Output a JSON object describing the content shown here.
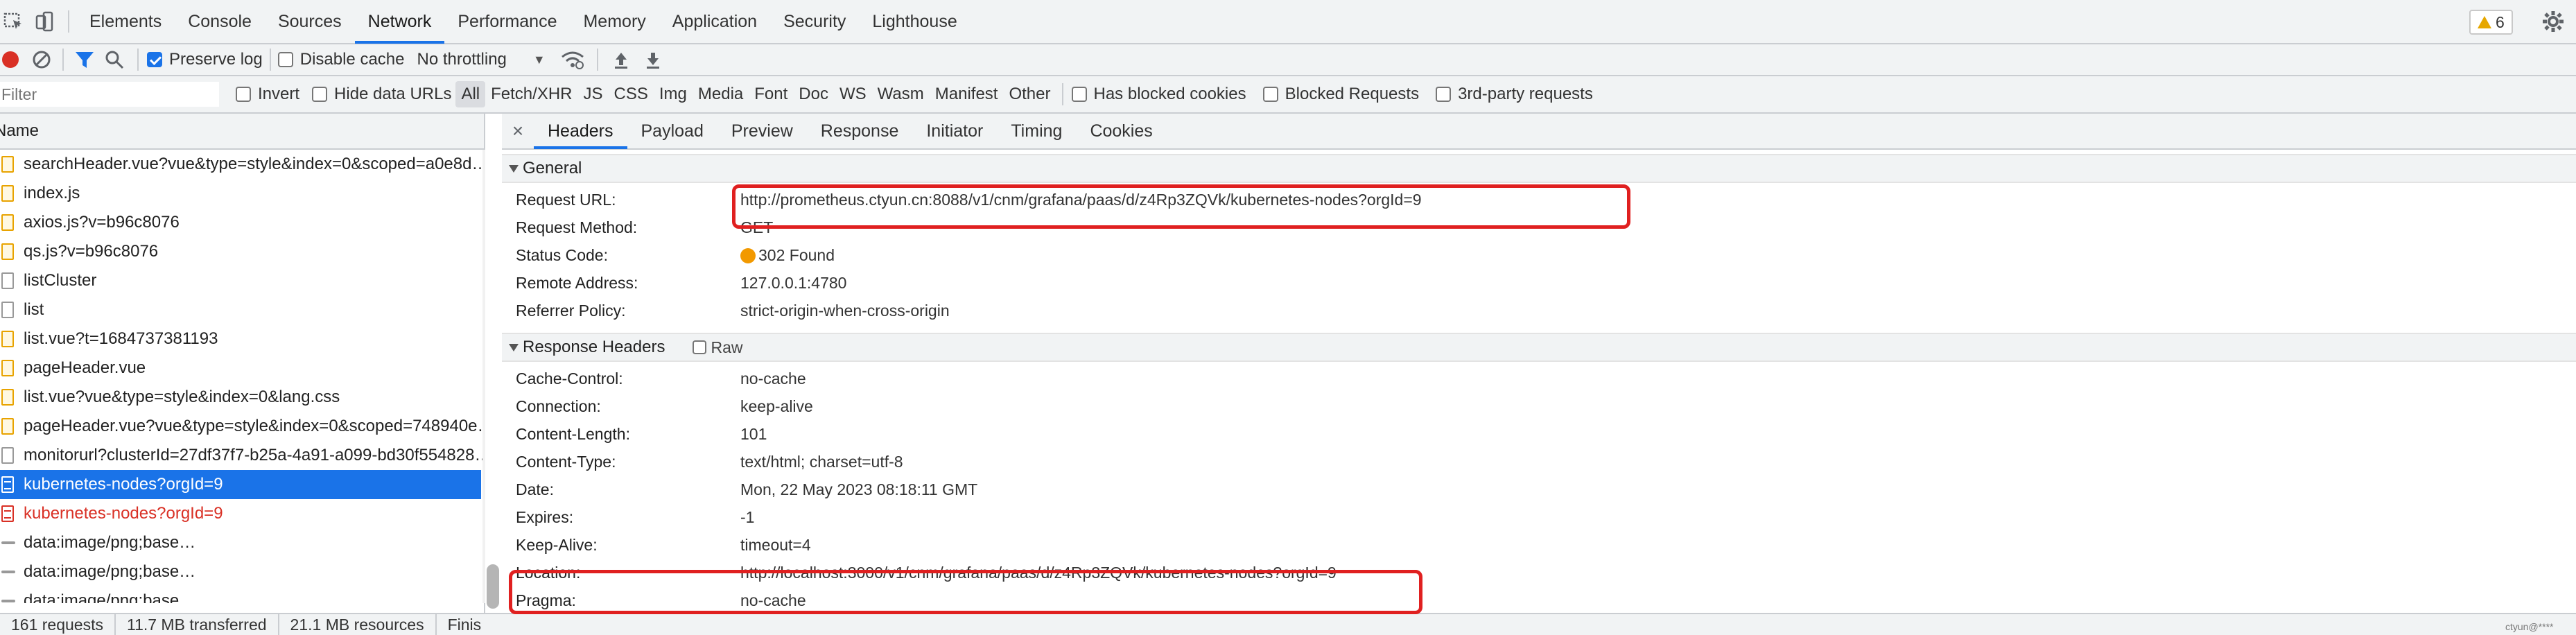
{
  "tabs": [
    "Elements",
    "Console",
    "Sources",
    "Network",
    "Performance",
    "Memory",
    "Application",
    "Security",
    "Lighthouse"
  ],
  "active_tab": "Network",
  "warnings_count": "6",
  "toolbar": {
    "preserve_log": "Preserve log",
    "disable_cache": "Disable cache",
    "throttling": "No throttling"
  },
  "filterbar": {
    "placeholder": "Filter",
    "invert": "Invert",
    "hide_data_urls": "Hide data URLs",
    "types": [
      "All",
      "Fetch/XHR",
      "JS",
      "CSS",
      "Img",
      "Media",
      "Font",
      "Doc",
      "WS",
      "Wasm",
      "Manifest",
      "Other"
    ],
    "has_blocked_cookies": "Has blocked cookies",
    "blocked_requests": "Blocked Requests",
    "third_party": "3rd-party requests"
  },
  "list": {
    "header": "Name",
    "rows": [
      {
        "name": "searchHeader.vue?vue&type=style&index=0&scoped=a0e8d…",
        "icon": "js"
      },
      {
        "name": "index.js",
        "icon": "js"
      },
      {
        "name": "axios.js?v=b96c8076",
        "icon": "js"
      },
      {
        "name": "qs.js?v=b96c8076",
        "icon": "js"
      },
      {
        "name": "listCluster",
        "icon": "blank"
      },
      {
        "name": "list",
        "icon": "blank"
      },
      {
        "name": "list.vue?t=1684737381193",
        "icon": "js"
      },
      {
        "name": "pageHeader.vue",
        "icon": "js"
      },
      {
        "name": "list.vue?vue&type=style&index=0&lang.css",
        "icon": "js"
      },
      {
        "name": "pageHeader.vue?vue&type=style&index=0&scoped=748940e…",
        "icon": "js"
      },
      {
        "name": "monitorurl?clusterId=27df37f7-b25a-4a91-a099-bd30f554828…",
        "icon": "blank"
      },
      {
        "name": "kubernetes-nodes?orgId=9",
        "icon": "selected"
      },
      {
        "name": "kubernetes-nodes?orgId=9",
        "icon": "error"
      },
      {
        "name": "data:image/png;base…",
        "icon": "img"
      },
      {
        "name": "data:image/png;base…",
        "icon": "img"
      },
      {
        "name": "data:image/png;base…",
        "icon": "img"
      }
    ]
  },
  "status": {
    "requests": "161 requests",
    "transferred": "11.7 MB transferred",
    "resources": "21.1 MB resources",
    "finish": "Finis"
  },
  "detail_tabs": [
    "Headers",
    "Payload",
    "Preview",
    "Response",
    "Initiator",
    "Timing",
    "Cookies"
  ],
  "general": {
    "title": "General",
    "rows": [
      {
        "k": "Request URL:",
        "v": "http://prometheus.ctyun.cn:8088/v1/cnm/grafana/paas/d/z4Rp3ZQVk/kubernetes-nodes?orgId=9"
      },
      {
        "k": "Request Method:",
        "v": "GET"
      },
      {
        "k": "Status Code:",
        "v": "302 Found"
      },
      {
        "k": "Remote Address:",
        "v": "127.0.0.1:4780"
      },
      {
        "k": "Referrer Policy:",
        "v": "strict-origin-when-cross-origin"
      }
    ]
  },
  "response_headers": {
    "title": "Response Headers",
    "raw": "Raw",
    "rows": [
      {
        "k": "Cache-Control:",
        "v": "no-cache"
      },
      {
        "k": "Connection:",
        "v": "keep-alive"
      },
      {
        "k": "Content-Length:",
        "v": "101"
      },
      {
        "k": "Content-Type:",
        "v": "text/html; charset=utf-8"
      },
      {
        "k": "Date:",
        "v": "Mon, 22 May 2023 08:18:11 GMT"
      },
      {
        "k": "Expires:",
        "v": "-1"
      },
      {
        "k": "Keep-Alive:",
        "v": "timeout=4"
      },
      {
        "k": "Location:",
        "v": "http://localhost:3000/v1/cnm/grafana/paas/d/z4Rp3ZQVk/kubernetes-nodes?orgId=9"
      },
      {
        "k": "Pragma:",
        "v": "no-cache"
      }
    ]
  },
  "watermark": "ctyun@****",
  "colors": {
    "accent": "#1a73e8",
    "error": "#d93025",
    "highlight": "#e02020",
    "status_dot": "#f29900"
  }
}
